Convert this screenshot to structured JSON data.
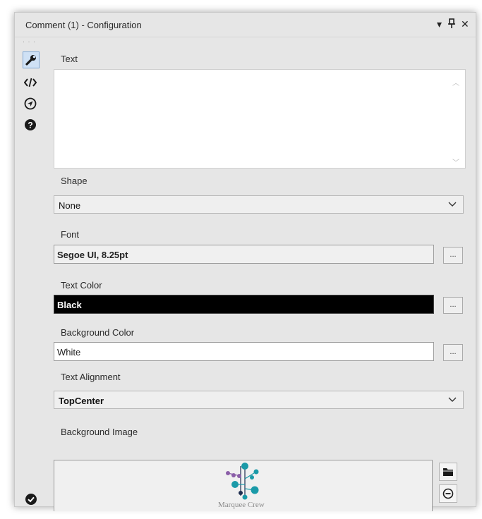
{
  "window": {
    "title": "Comment (1) - Configuration",
    "controls": {
      "menu": "▾",
      "pin": "⊥",
      "close": "✕"
    }
  },
  "sidebar": {
    "dots": "· · ·",
    "items": [
      {
        "icon": "wrench-icon",
        "active": true
      },
      {
        "icon": "code-icon",
        "active": false
      },
      {
        "icon": "compass-icon",
        "active": false
      },
      {
        "icon": "help-icon",
        "active": false
      }
    ],
    "status_icon": "checkmark-circle-icon"
  },
  "form": {
    "text_label": "Text",
    "text_value": "",
    "shape_label": "Shape",
    "shape_value": "None",
    "font_label": "Font",
    "font_value": "Segoe UI, 8.25pt",
    "font_button": "...",
    "text_color_label": "Text Color",
    "text_color_value": "Black",
    "text_color_hex": "#000000",
    "text_color_button": "...",
    "bg_color_label": "Background Color",
    "bg_color_value": "White",
    "bg_color_hex": "#ffffff",
    "bg_color_button": "...",
    "alignment_label": "Text Alignment",
    "alignment_value": "TopCenter",
    "bg_image_label": "Background Image",
    "bg_image_caption": "Marquee Crew"
  },
  "colors": {
    "panel_bg": "#e6e6e6",
    "accent": "#1a9aa8",
    "logo_purple": "#8b5fa8",
    "logo_navy": "#1e2d4f"
  }
}
